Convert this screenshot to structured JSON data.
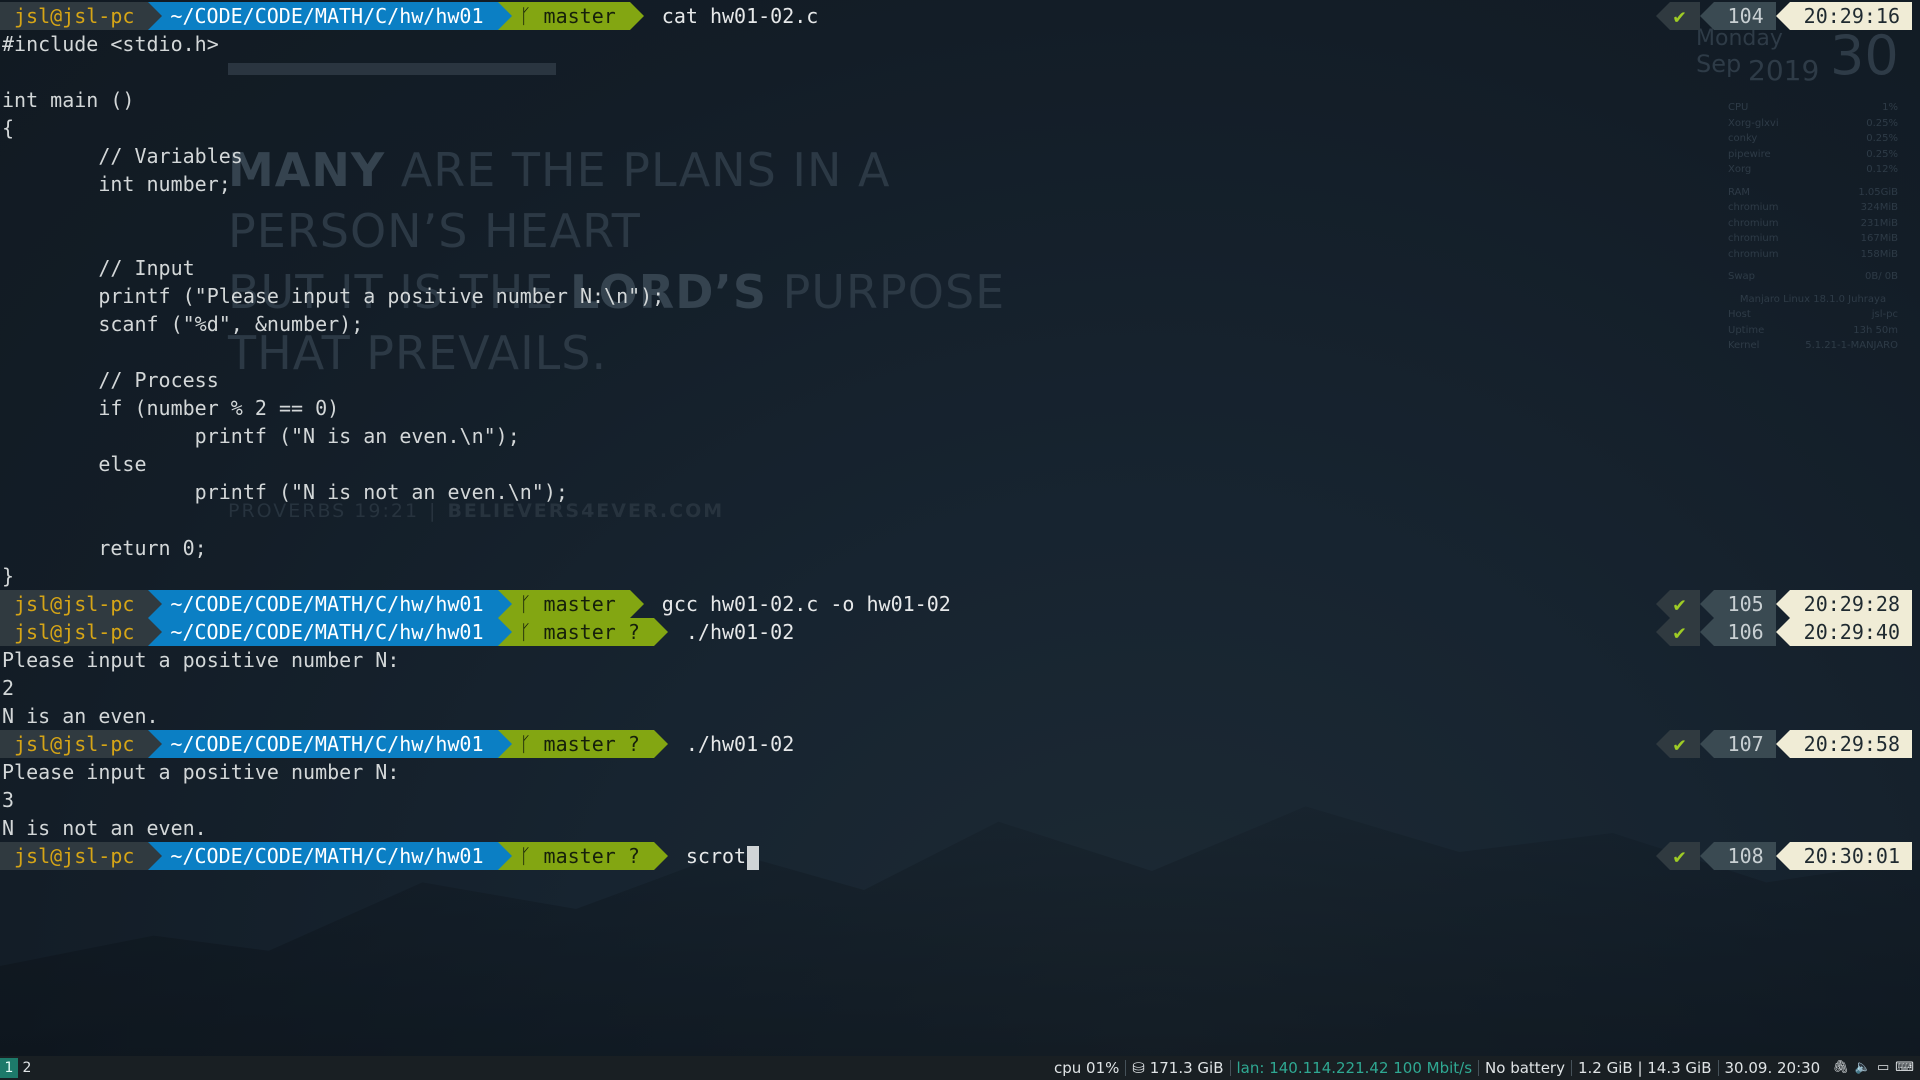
{
  "wallpaper": {
    "verse_lines": [
      [
        "MANY",
        " ARE THE PLANS IN A"
      ],
      [
        "",
        "PERSON’S HEART"
      ],
      [
        "BUT IT IS THE ",
        "LORD’S",
        " PURPOSE"
      ],
      [
        "",
        "THAT PREVAILS."
      ]
    ],
    "reference": "PROVERBS 19:21",
    "site": "BELIEVERS4EVER.COM"
  },
  "conky": {
    "day_name": "Monday",
    "month": "Sep",
    "year": "2019",
    "day": "30",
    "rows": [
      [
        "CPU",
        "1%"
      ],
      [
        "Xorg-glxvi",
        "0.25%"
      ],
      [
        "conky",
        "0.25%"
      ],
      [
        "pipewire",
        "0.25%"
      ],
      [
        "Xorg",
        "0.12%"
      ],
      [
        "RAM",
        "1.05GiB"
      ],
      [
        "chromium",
        "324MiB"
      ],
      [
        "chromium",
        "231MiB"
      ],
      [
        "chromium",
        "167MiB"
      ],
      [
        "chromium",
        "158MiB"
      ],
      [
        "Swap",
        "0B/ 0B"
      ],
      [
        "Manjaro Linux 18.1.0 Juhraya",
        ""
      ],
      [
        "Host",
        "jsl-pc"
      ],
      [
        "Uptime",
        "13h 50m"
      ],
      [
        "Kernel",
        "5.1.21-1-MANJARO"
      ]
    ]
  },
  "prompt": {
    "user": "jsl@jsl-pc",
    "path": "~/CODE/CODE/MATH/C/hw/hw01",
    "branch_icon": "git-branch-icon",
    "check_glyph": "✔"
  },
  "commands": [
    {
      "branch": "ᚴ master",
      "cmd": "cat hw01-02.c",
      "num": "104",
      "time": "20:29:16"
    },
    {
      "branch": "ᚴ master",
      "cmd": "gcc hw01-02.c -o hw01-02",
      "num": "105",
      "time": "20:29:28"
    },
    {
      "branch": "ᚴ master ?",
      "cmd": "./hw01-02",
      "num": "106",
      "time": "20:29:40"
    },
    {
      "branch": "ᚴ master ?",
      "cmd": "./hw01-02",
      "num": "107",
      "time": "20:29:58"
    },
    {
      "branch": "ᚴ master ?",
      "cmd": "scrot",
      "num": "108",
      "time": "20:30:01"
    }
  ],
  "source_lines": [
    "#include <stdio.h>",
    "",
    "int main ()",
    "{",
    "        // Variables",
    "        int number;",
    "",
    "",
    "        // Input",
    "        printf (\"Please input a positive number N:\\n\");",
    "        scanf (\"%d\", &number);",
    "",
    "        // Process",
    "        if (number % 2 == 0)",
    "                printf (\"N is an even.\\n\");",
    "        else",
    "                printf (\"N is not an even.\\n\");",
    "",
    "        return 0;",
    "}"
  ],
  "run1_output": [
    "Please input a positive number N:",
    "2",
    "N is an even."
  ],
  "run2_output": [
    "Please input a positive number N:",
    "3",
    "N is not an even."
  ],
  "statusbar": {
    "workspaces": [
      "1",
      "2"
    ],
    "active_workspace": "1",
    "cpu": "cpu  01%",
    "disk": "⛁ 171.3 GiB",
    "lan": "lan: 140.114.221.42 100 Mbit/s",
    "battery": "No battery",
    "memory": "1.2 GiB | 14.3 GiB",
    "datetime": "30.09. 20:30",
    "tray_icons": [
      "link-icon",
      "volume-icon",
      "display-icon",
      "keyboard-icon"
    ]
  }
}
